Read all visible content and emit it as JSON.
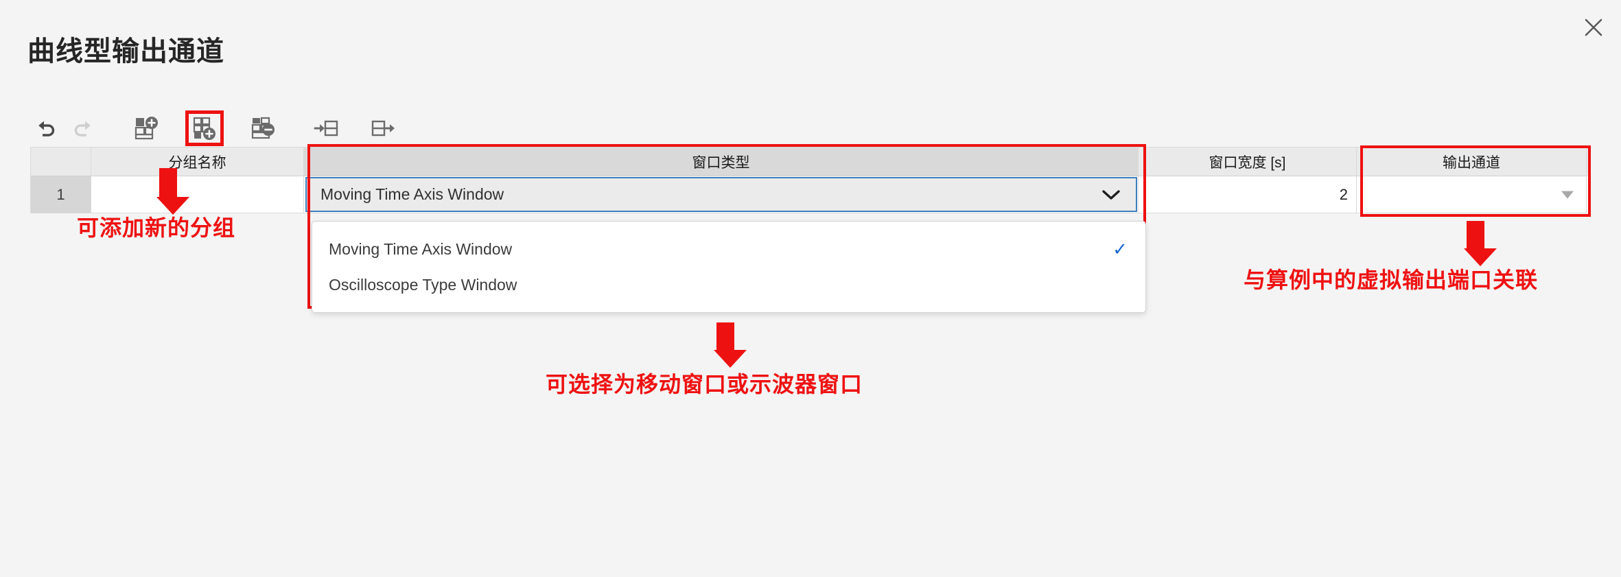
{
  "window": {
    "title": "曲线型输出通道",
    "close_label": "×"
  },
  "toolbar": {
    "buttons": [
      {
        "name": "undo",
        "label": "撤销",
        "icon": "undo-icon",
        "enabled": true
      },
      {
        "name": "redo",
        "label": "重做",
        "icon": "redo-icon",
        "enabled": false
      },
      {
        "name": "add-group",
        "label": "添加分组",
        "icon": "table-add-icon",
        "enabled": true
      },
      {
        "name": "add-sub-group",
        "label": "添加子分组",
        "icon": "table-add-sub-icon",
        "enabled": true,
        "highlighted": true
      },
      {
        "name": "remove-group",
        "label": "删除分组",
        "icon": "table-remove-icon",
        "enabled": true
      },
      {
        "name": "indent-row",
        "label": "右移",
        "icon": "indent-right-icon",
        "enabled": true
      },
      {
        "name": "outdent-row",
        "label": "左移",
        "icon": "outdent-right-icon",
        "enabled": true
      }
    ]
  },
  "table": {
    "columns": [
      {
        "key": "rownum",
        "label": ""
      },
      {
        "key": "name",
        "label": "分组名称"
      },
      {
        "key": "wintype",
        "label": "窗口类型"
      },
      {
        "key": "winwidth",
        "label": "窗口宽度 [s]"
      },
      {
        "key": "outchan",
        "label": "输出通道"
      }
    ],
    "rows": [
      {
        "rownum": "1",
        "name": "",
        "wintype": "Moving Time Axis Window",
        "winwidth": "2",
        "outchan": ""
      }
    ]
  },
  "dropdown": {
    "open": true,
    "options": [
      {
        "label": "Moving Time Axis Window",
        "selected": true,
        "check": "✓"
      },
      {
        "label": "Oscilloscope Type Window",
        "selected": false,
        "check": ""
      }
    ]
  },
  "annotations": [
    {
      "name": "annotation-add-group",
      "text": "可添加新的分组"
    },
    {
      "name": "annotation-window-type",
      "text": "可选择为移动窗口或示波器窗口"
    },
    {
      "name": "annotation-output-port",
      "text": "与算例中的虚拟输出端口关联"
    }
  ],
  "colors": {
    "annotation_red": "#ee1111",
    "focus_blue": "#3c7fbe",
    "check_blue": "#1967d2",
    "header_gray": "#eaeaea",
    "background": "#f4f4f4"
  }
}
